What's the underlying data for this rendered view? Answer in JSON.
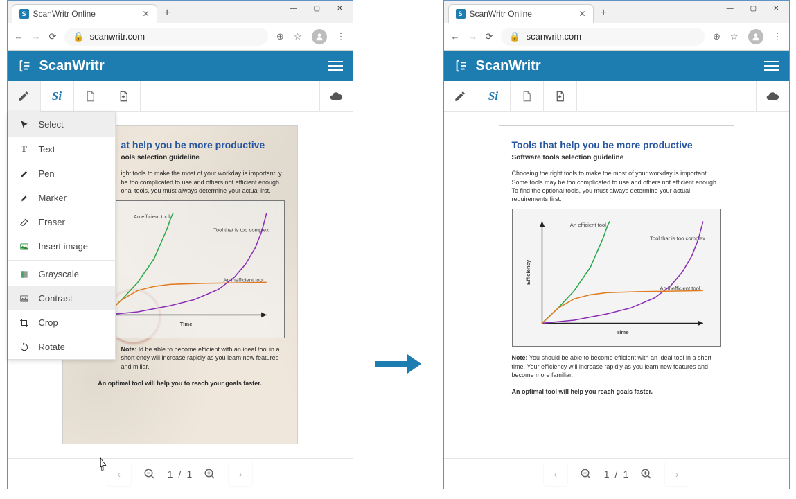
{
  "browser": {
    "tab_title": "ScanWritr Online",
    "url_host": "scanwritr.com"
  },
  "app": {
    "name": "ScanWritr"
  },
  "menu": {
    "select": "Select",
    "text": "Text",
    "pen": "Pen",
    "marker": "Marker",
    "eraser": "Eraser",
    "insert_image": "Insert image",
    "grayscale": "Grayscale",
    "contrast": "Contrast",
    "crop": "Crop",
    "rotate": "Rotate"
  },
  "doc": {
    "title": "Tools that help you be more productive",
    "subtitle": "Software tools selection guideline",
    "title_partial": "at help you be more productive",
    "subtitle_partial": "ools selection guideline",
    "para1": "Choosing the right tools to make the most of your workday is important. Some tools may be too complicated to use and others not efficient enough. To find the optional tools, you must always determine your actual requirements first.",
    "para1_partial": "ight tools to make the most of your workday is important. y be too complicated to use and others not efficient enough. onal tools, you must always determine your actual irst.",
    "note_label": "Note:",
    "note_body": " You should be able to become efficient with an ideal tool in a short time. Your efficiency will increase rapidly as you learn new features and become more familiar.",
    "note_body_partial": " ld be able to become efficient with an ideal tool in a short ency will increase rapidly as you learn new features and miliar.",
    "optimal_left": "An optimal tool will help you to reach your goals faster.",
    "optimal_right": "An optimal tool will help you reach goals faster."
  },
  "chart_data": {
    "type": "line",
    "xlabel": "Time",
    "ylabel": "Efficiency",
    "xlim": [
      0,
      10
    ],
    "ylim": [
      0,
      10
    ],
    "series": [
      {
        "name": "An efficient tool",
        "color": "#2ba84a",
        "x": [
          0,
          1,
          2,
          3,
          3.5,
          3.8,
          4,
          4.1,
          4.2
        ],
        "y": [
          0,
          1.5,
          3.2,
          5.5,
          7.3,
          8.4,
          9.3,
          9.7,
          10
        ]
      },
      {
        "name": "Tool that is too complex",
        "color": "#8a2db5",
        "x": [
          0,
          2,
          4,
          5.5,
          7,
          8,
          8.7,
          9.3,
          9.7,
          10
        ],
        "y": [
          0,
          0.3,
          0.9,
          1.5,
          2.5,
          3.7,
          5,
          6.6,
          8.2,
          10
        ]
      },
      {
        "name": "An inefficient tool",
        "color": "#e07b1f",
        "x": [
          0,
          1,
          2,
          3,
          4,
          6,
          8,
          10
        ],
        "y": [
          0,
          1.5,
          2.4,
          2.8,
          3,
          3.1,
          3.15,
          3.2
        ]
      }
    ]
  },
  "pager": {
    "current": "1",
    "sep": "/",
    "total": "1"
  }
}
